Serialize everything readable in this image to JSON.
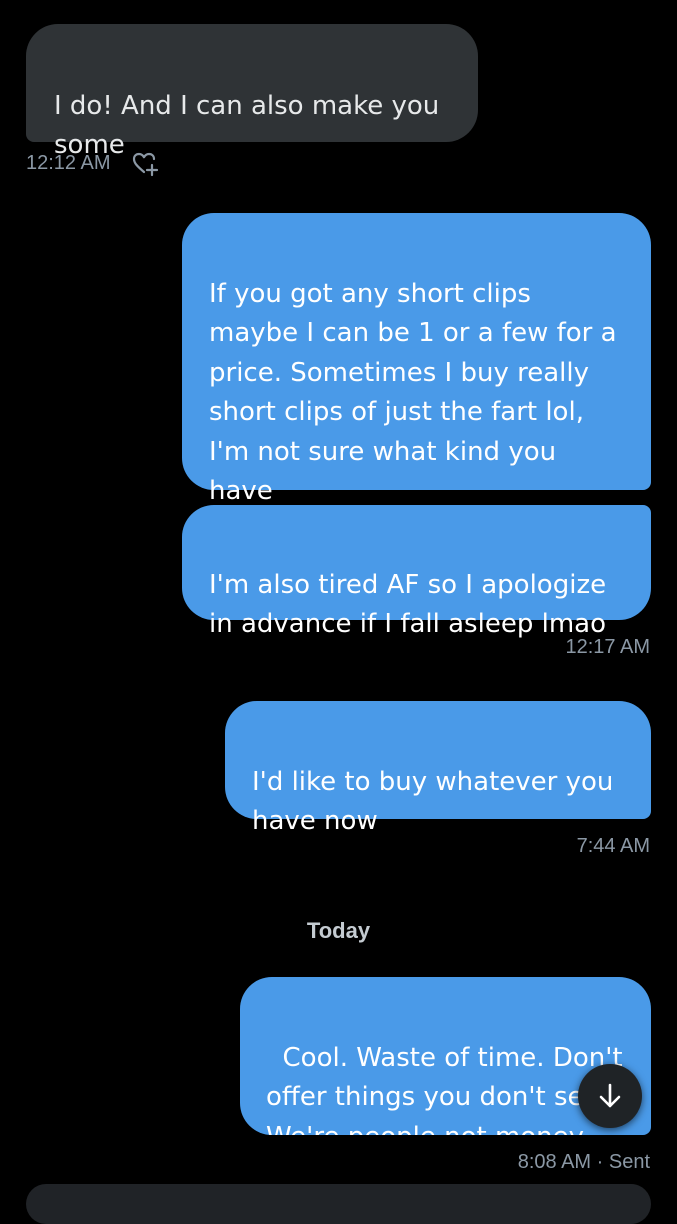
{
  "messages": [
    {
      "text": "I do! And I can also make you\nsome",
      "time": "12:12 AM"
    },
    {
      "text": "If you got any short clips\nmaybe I can be 1 or a few for a\nprice. Sometimes I buy really\nshort clips of just the fart lol,\nI'm not sure what kind you\nhave"
    },
    {
      "text": "I'm also tired AF so I apologize\nin advance if I fall asleep lmao",
      "time": "12:17 AM"
    },
    {
      "text": "I'd like to buy whatever you\nhave now",
      "time": "7:44 AM"
    },
    {
      "text": "Cool. Waste of time. Don't\noffer things you don't sell\nWe're people not money",
      "time": "8:08 AM · Sent"
    }
  ],
  "divider": {
    "label": "Today"
  },
  "icons": {
    "react": "heart-plus-icon",
    "scroll": "arrow-down-icon"
  },
  "colors": {
    "background": "#000000",
    "incoming_bubble": "#2f3336",
    "outgoing_bubble": "#4a9ae8",
    "meta_text": "#8b98a5"
  }
}
